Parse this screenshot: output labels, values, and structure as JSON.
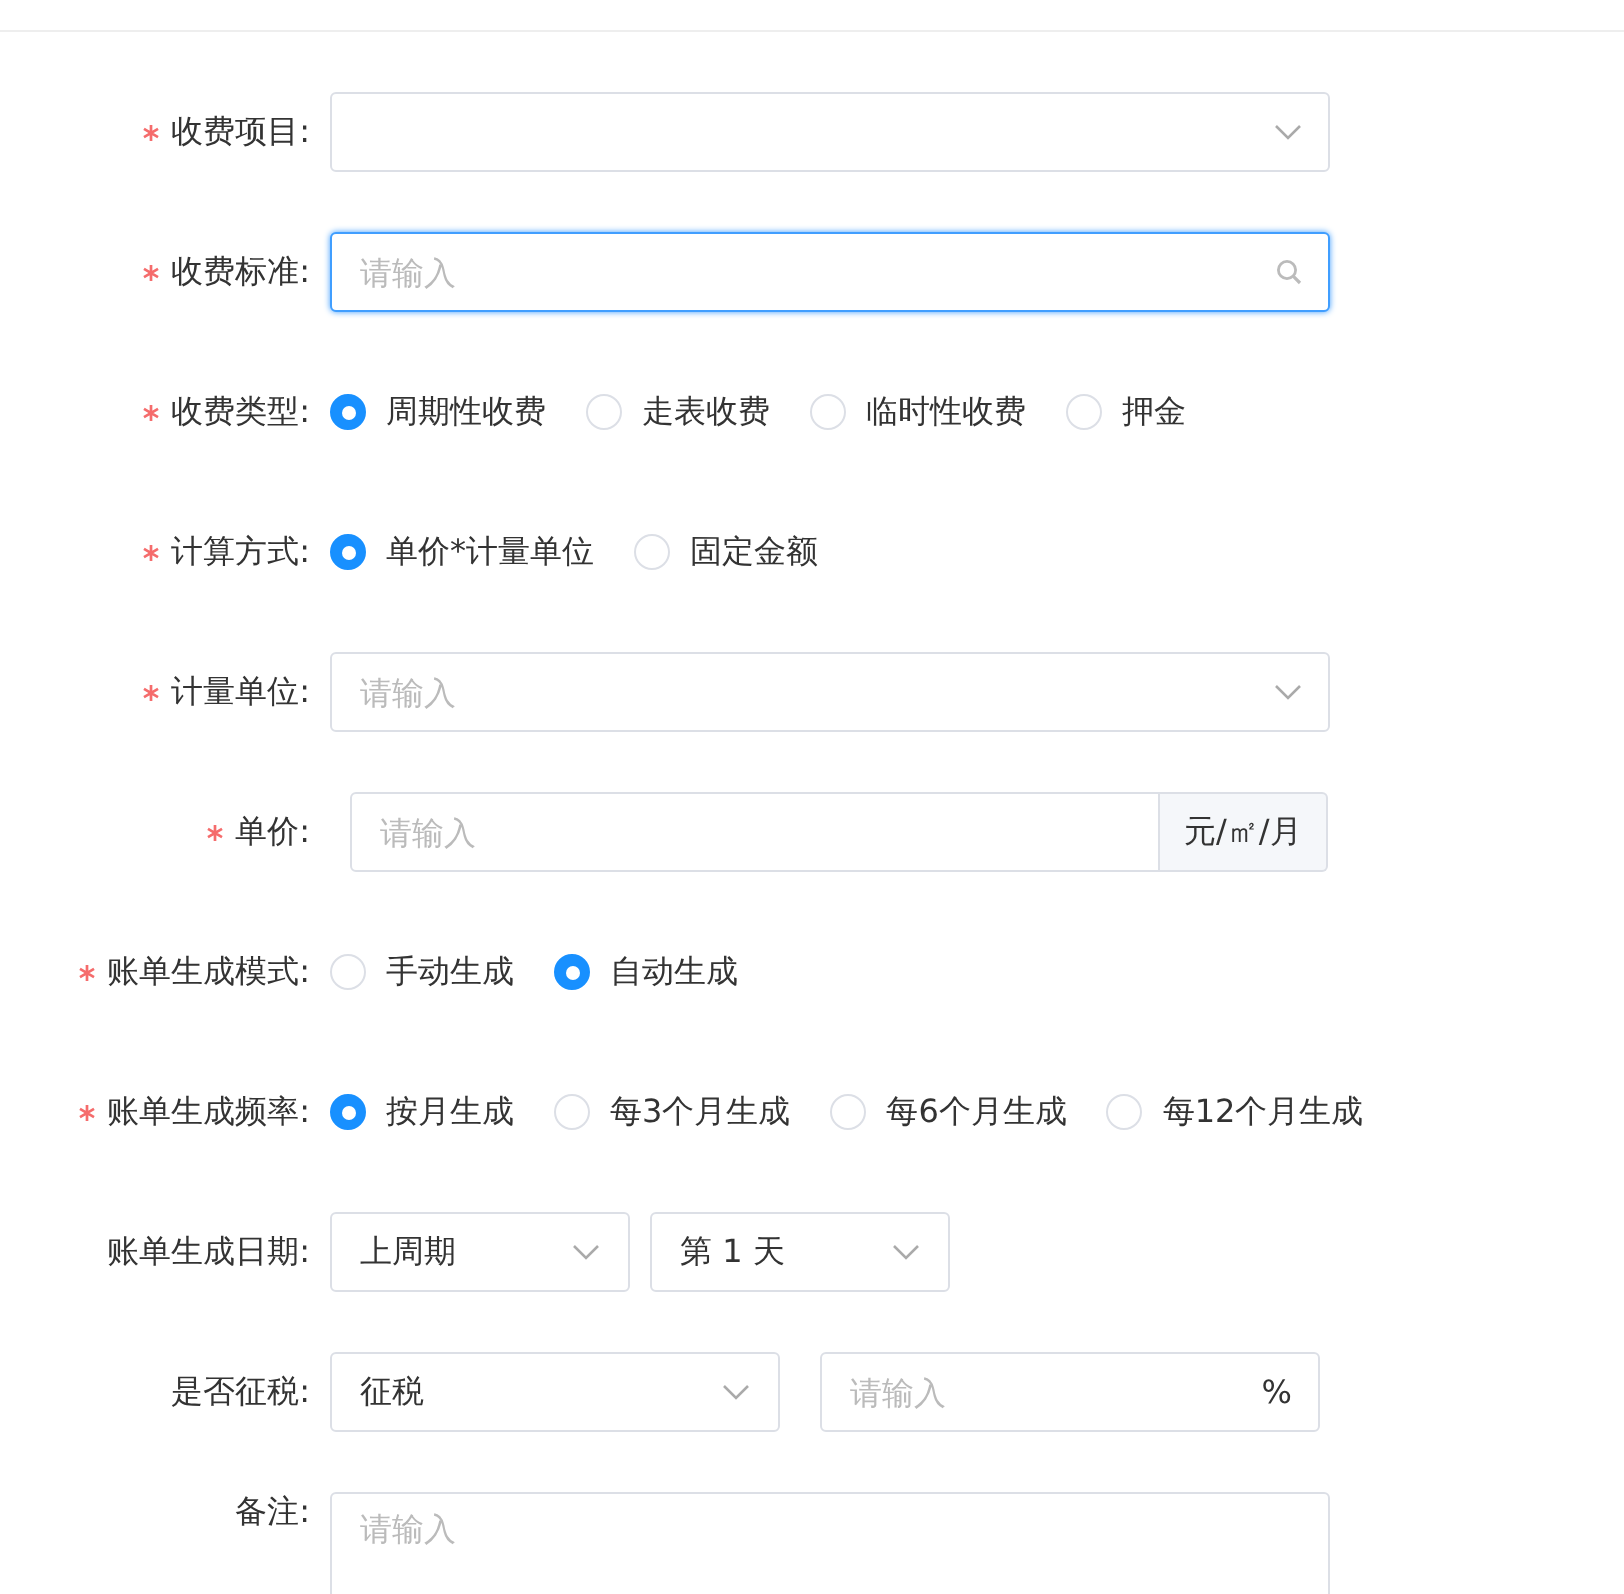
{
  "fields": [
    {
      "kind": "select",
      "label": "收费项目:",
      "required": true
    },
    {
      "kind": "search",
      "label": "收费标准:",
      "required": true,
      "placeholder": "请输入",
      "focused": true
    },
    {
      "kind": "radio",
      "label": "收费类型:",
      "required": true,
      "options": [
        {
          "label": "周期性收费",
          "selected": true
        },
        {
          "label": "走表收费",
          "selected": false
        },
        {
          "label": "临时性收费",
          "selected": false
        },
        {
          "label": "押金",
          "selected": false
        }
      ]
    },
    {
      "kind": "radio",
      "label": "计算方式:",
      "required": true,
      "options": [
        {
          "label": "单价*计量单位",
          "selected": true
        },
        {
          "label": "固定金额",
          "selected": false
        }
      ]
    },
    {
      "kind": "select",
      "label": "计量单位:",
      "required": true,
      "placeholder": "请输入"
    },
    {
      "kind": "input-append",
      "label": "单价:",
      "required": true,
      "placeholder": "请输入",
      "append": "元/㎡/月"
    },
    {
      "kind": "radio",
      "label": "账单生成模式:",
      "required": true,
      "options": [
        {
          "label": "手动生成",
          "selected": false
        },
        {
          "label": "自动生成",
          "selected": true
        }
      ]
    },
    {
      "kind": "radio",
      "label": "账单生成频率:",
      "required": true,
      "options": [
        {
          "label": "按月生成",
          "selected": true
        },
        {
          "label": "每3个月生成",
          "selected": false
        },
        {
          "label": "每6个月生成",
          "selected": false
        },
        {
          "label": "每12个月生成",
          "selected": false
        }
      ]
    },
    {
      "kind": "select-pair",
      "label": "账单生成日期:",
      "required": false,
      "selects": [
        {
          "value": "上周期"
        },
        {
          "value": "第 1 天"
        }
      ]
    },
    {
      "kind": "select-input",
      "label": "是否征税:",
      "required": false,
      "select": {
        "value": "征税"
      },
      "input": {
        "placeholder": "请输入",
        "suffix": "%"
      }
    },
    {
      "kind": "textarea",
      "label": "备注:",
      "required": false,
      "placeholder": "请输入"
    }
  ]
}
